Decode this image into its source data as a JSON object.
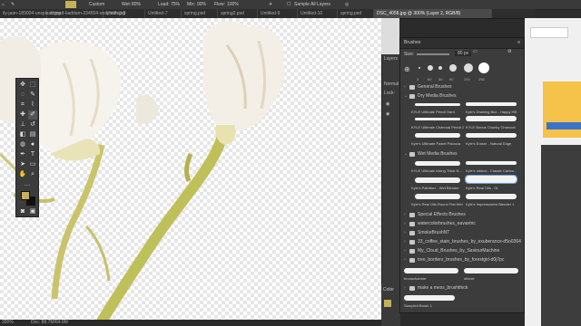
{
  "options_bar": {
    "brush_name": "Custom",
    "wet_label": "Wet:",
    "wet_value": "80%",
    "load_label": "Load:",
    "load_value": "75%",
    "mix_label": "Mix:",
    "mix_value": "90%",
    "flow_label": "Flow:",
    "flow_value": "100%",
    "sample_all_layers": "Sample All Layers"
  },
  "tabs": [
    {
      "label": "ily-jaan-189004-unsplash.jpg"
    },
    {
      "label": "ahmed-kaddam-334554-unsplash.jpg"
    },
    {
      "label": "Untitled-8"
    },
    {
      "label": "Untitled-7"
    },
    {
      "label": "spring.psd"
    },
    {
      "label": "spring2.psd"
    },
    {
      "label": "Untitled-9"
    },
    {
      "label": "Untitled-10"
    },
    {
      "label": "spring.psd"
    },
    {
      "label": "DSC_4058.jpg @ 300% (Layer 2, RGB/8)"
    }
  ],
  "status": {
    "zoom": "300%",
    "doc": "Doc: 88.7M/64.9M"
  },
  "layers_panel": {
    "title": "Layers",
    "mode": "Normal",
    "lock": "Lock:"
  },
  "color_panel": {
    "title": "Color"
  },
  "brushes": {
    "panel_title": "Brushes",
    "size_label": "Size:",
    "size_value": "80 px",
    "tip_sizes": [
      "3",
      "60",
      "30",
      "90",
      "200",
      "256"
    ],
    "groups": [
      {
        "label": "General Brushes",
        "open": false
      },
      {
        "label": "Dry Media Brushes",
        "open": true
      },
      {
        "label": "Wet Media Brushes",
        "open": true
      },
      {
        "label": "Special Effects Brushes",
        "open": false
      },
      {
        "label": "watercolorbrushes_eavantric",
        "open": false
      },
      {
        "label": "SmokeBrushNT",
        "open": false
      },
      {
        "label": "33_coffee_stain_brushes_by_exuberance-d5o0364",
        "open": false
      },
      {
        "label": "My_Cloud_Brushes_by_SaviourMachine",
        "open": false
      },
      {
        "label": "tree_borders_brushes_by_forestgirl-d0j7pc",
        "open": false
      }
    ],
    "dry_brushes": [
      "KYLE Ultimate Pencil Hard",
      "Kyle's Drawing Box - Happy HB",
      "KYLE Ultimate Charcoal Pencil 25px",
      "KYLE Bonus Chunky Charcoal",
      "Kyle's Ultimate Pastel Palooza",
      "Kyle's Eraser - Natural Edge"
    ],
    "wet_brushes": [
      "KYLE Ultimate Inking Thick N...",
      "Kyle's Inkbox - Classic Cartoo...",
      "Kyle's Paintbox - Wet Blender",
      "Kyle's Real Oils - 01",
      "Kyle's Real Oils Round Flat Wet",
      "Kyle's Impressionist Blender 1"
    ],
    "bottom_brushes": [
      "brooscharmer",
      "shimie",
      "make a mess_brushthick",
      "Sampled Brush 1"
    ]
  },
  "colors": {
    "foreground": "#c4b25a",
    "background": "#111111",
    "accent": "#4a90d9"
  }
}
